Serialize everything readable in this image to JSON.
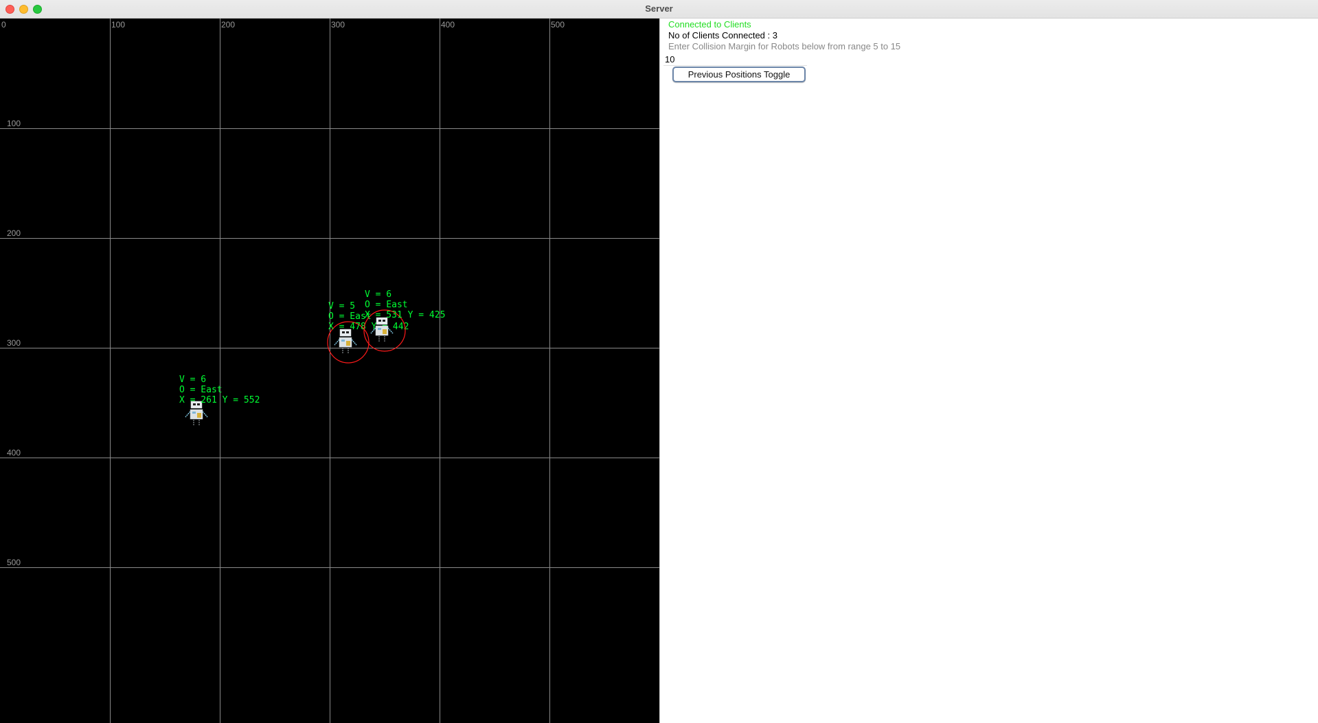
{
  "window": {
    "title": "Server"
  },
  "canvas": {
    "background": "#000000",
    "grid_color": "#8a8a8a",
    "label_color": "#9a9a9a",
    "robot_text_color": "#00ff33",
    "collision_color": "#ff1a1a",
    "x_labels": [
      "0",
      "100",
      "200",
      "300",
      "400",
      "500"
    ],
    "y_labels": [
      "100",
      "200",
      "300",
      "400",
      "500"
    ]
  },
  "robots": [
    {
      "velocity": "V = 6",
      "orientation": "O = East",
      "position": "X = 261 Y = 552",
      "colliding": false
    },
    {
      "velocity": "V = 5",
      "orientation": "O = East",
      "position": "X = 478 Y = 442",
      "colliding": true
    },
    {
      "velocity": "V = 6",
      "orientation": "O = East",
      "position": "X = 531 Y = 425",
      "colliding": true
    }
  ],
  "panel": {
    "status": "Connected to Clients",
    "status_color": "#22dd22",
    "client_count": "No of Clients Connected : 3",
    "margin_prompt": "Enter Collision Margin for Robots below from range 5 to 15",
    "margin_value": "10",
    "toggle_label": "Previous Positions Toggle"
  }
}
